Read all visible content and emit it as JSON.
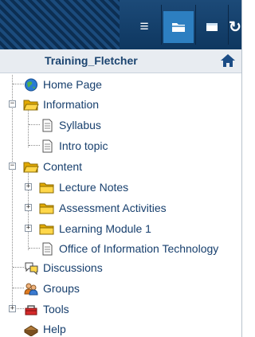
{
  "toolbar": {
    "buttons": [
      {
        "name": "menu-list-icon",
        "glyph": "≡"
      },
      {
        "name": "folder-icon",
        "glyph": "▬",
        "active": true
      },
      {
        "name": "window-icon",
        "glyph": "■"
      },
      {
        "name": "refresh-icon",
        "glyph": "↻"
      }
    ]
  },
  "course": {
    "title": "Training_Fletcher"
  },
  "tree": {
    "home_page": "Home Page",
    "information": "Information",
    "syllabus": "Syllabus",
    "intro_topic": "Intro topic",
    "content": "Content",
    "lecture_notes": "Lecture Notes",
    "assessment_activities": "Assessment Activities",
    "learning_module_1": "Learning Module 1",
    "office_it": "Office of Information Technology",
    "discussions": "Discussions",
    "groups": "Groups",
    "tools": "Tools",
    "help": "Help"
  },
  "toggles": {
    "expanded": "−",
    "collapsed": "+"
  },
  "colors": {
    "toolbar": "#0e3760",
    "accent": "#2d7fc1",
    "link": "#173f6d",
    "folder": "#f2c200"
  }
}
